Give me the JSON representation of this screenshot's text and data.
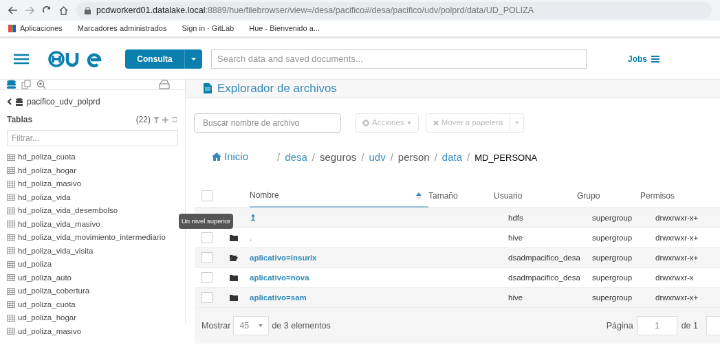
{
  "browser": {
    "url_host": "pcdworkerd01.datalake.local",
    "url_rest": ":8889/hue/filebrowser/view=/desa/pacifico#/desa/pacifico/udv/polprd/data/UD_POLIZA"
  },
  "bookmarks": [
    "Aplicaciones",
    "Marcadores administrados",
    "Sign in · GitLab",
    "Hue - Bienvenido a..."
  ],
  "topbar": {
    "query_button": "Consulta",
    "search_placeholder": "Search data and saved documents...",
    "jobs": "Jobs"
  },
  "sidebar": {
    "database": "pacifico_udv_polprd",
    "section": "Tablas",
    "count": "(22)",
    "filter_placeholder": "Filtrar...",
    "tables": [
      "hd_poliza_cuota",
      "hd_poliza_hogar",
      "hd_poliza_masivo",
      "hd_poliza_vida",
      "hd_poliza_vida_desembolso",
      "hd_poliza_vida_masivo",
      "hd_poliza_vida_movimiento_intermediario",
      "hd_poliza_vida_visita",
      "ud_poliza",
      "ud_poliza_auto",
      "ud_poliza_cobertura",
      "ud_poliza_cuota",
      "ud_poliza_hogar",
      "ud_poliza_masivo"
    ]
  },
  "main": {
    "title": "Explorador de archivos",
    "file_search_placeholder": "Buscar nombre de archivo",
    "actions": "Acciones",
    "trash": "Mover a papelera",
    "home": "Inicio",
    "select_all_checked": false,
    "path": [
      {
        "sep": "/",
        "label": "desa",
        "link": true
      },
      {
        "sep": "/",
        "label": "seguros",
        "link": false
      },
      {
        "sep": "/",
        "label": "udv",
        "link": true
      },
      {
        "sep": "/",
        "label": "person",
        "link": false
      },
      {
        "sep": "/",
        "label": "data",
        "link": true
      },
      {
        "sep": "/",
        "label": "MD_PERSONA",
        "link": false
      }
    ],
    "columns": [
      "Nombre",
      "Tamaño",
      "Usuario",
      "Grupo",
      "Permisos"
    ],
    "tooltip": "Un nivel superior",
    "rows": [
      {
        "kind": "parent",
        "name": "↥",
        "user": "hdfs",
        "group": "supergroup",
        "perms": "drwxrwxr-x+"
      },
      {
        "kind": "folder",
        "checked": false,
        "name": ".",
        "user": "hive",
        "group": "supergroup",
        "perms": "drwxrwxr-x+"
      },
      {
        "kind": "open-folder",
        "checked": false,
        "name": "aplicativo=insurix",
        "user": "dsadmpacifico_desa",
        "group": "supergroup",
        "perms": "drwxrwxr-x+"
      },
      {
        "kind": "folder",
        "checked": false,
        "name": "aplicativo=nova",
        "user": "dsadmpacifico_desa",
        "group": "supergroup",
        "perms": "drwxrwxr-x"
      },
      {
        "kind": "folder",
        "checked": false,
        "name": "aplicativo=sam",
        "user": "hive",
        "group": "supergroup",
        "perms": "drwxrwxr-x+"
      }
    ],
    "footer": {
      "show": "Mostrar",
      "page_size": "45",
      "count_text": "de 3 elementos",
      "page_label": "Página",
      "page": "1",
      "of": "de 1"
    }
  }
}
